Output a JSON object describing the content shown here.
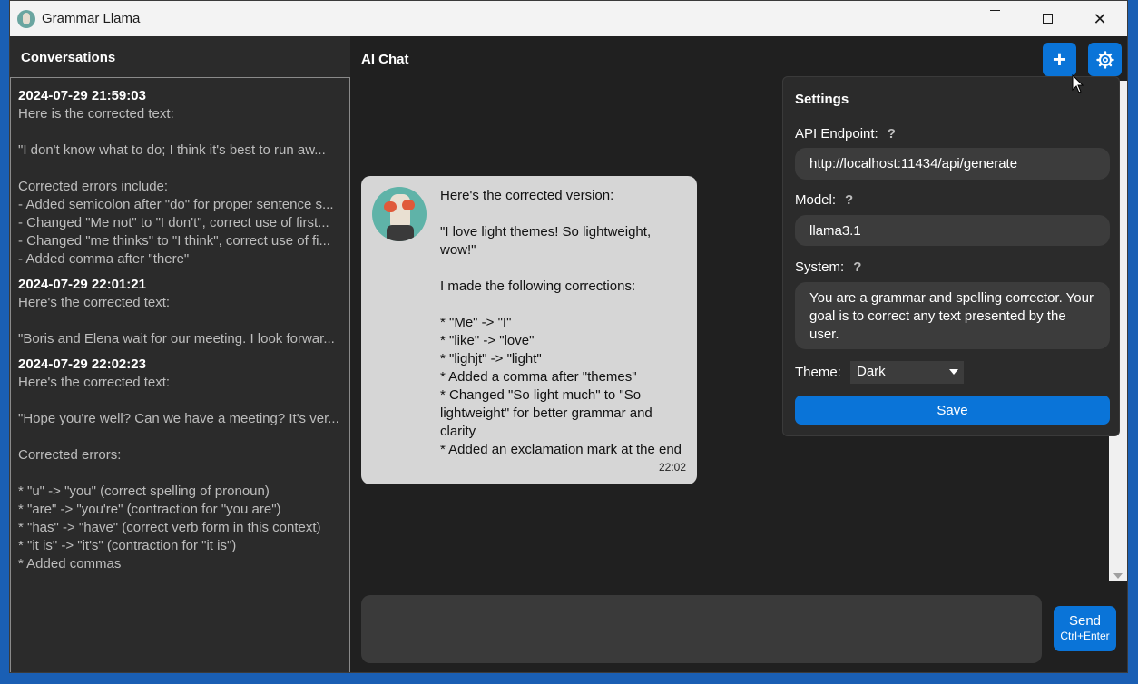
{
  "window": {
    "title": "Grammar Llama"
  },
  "sidebar": {
    "header": "Conversations",
    "conversations": [
      {
        "timestamp": "2024-07-29 21:59:03",
        "lines": [
          "Here is the corrected text:",
          "",
          "\"I don't know what to do; I think it's best to run aw...",
          "",
          "Corrected errors include:",
          "- Added semicolon after \"do\" for proper sentence s...",
          "- Changed \"Me not\" to \"I don't\", correct use of first...",
          "- Changed \"me thinks\" to \"I think\", correct use of fi...",
          "- Added comma after \"there\""
        ]
      },
      {
        "timestamp": "2024-07-29 22:01:21",
        "lines": [
          "Here's the corrected text:",
          "",
          "\"Boris and Elena wait for our meeting. I look forwar..."
        ]
      },
      {
        "timestamp": "2024-07-29 22:02:23",
        "lines": [
          "Here's the corrected text:",
          "",
          "\"Hope you're well? Can we have a meeting? It's ver...",
          "",
          "Corrected errors:",
          "",
          "* \"u\" -> \"you\" (correct spelling of pronoun)",
          "* \"are\" -> \"you're\" (contraction for \"you are\")",
          "* \"has\" -> \"have\" (correct verb form in this context)",
          "* \"it is\" -> \"it's\" (contraction for \"it is\")",
          "* Added commas"
        ]
      }
    ]
  },
  "chat": {
    "title": "AI Chat",
    "message": {
      "lines": [
        "Here's the corrected version:",
        "",
        "\"I love light themes! So lightweight,",
        "wow!\"",
        "",
        "I made the following corrections:",
        "",
        "* \"Me\" -> \"I\"",
        "* \"like\" -> \"love\"",
        "* \"lighjt\" -> \"light\"",
        "* Added a comma after \"themes\"",
        "* Changed \"So light much\" to \"So",
        "lightweight\" for better grammar and",
        "clarity",
        "* Added an exclamation mark at the end"
      ],
      "time": "22:02"
    },
    "input_value": "",
    "send": {
      "label": "Send",
      "hint": "Ctrl+Enter"
    }
  },
  "settings": {
    "title": "Settings",
    "api_endpoint_label": "API Endpoint:",
    "api_endpoint_value": "http://localhost:11434/api/generate",
    "model_label": "Model:",
    "model_value": "llama3.1",
    "system_label": "System:",
    "system_value": "You are a grammar and spelling corrector. Your goal is to correct any text presented by the user.",
    "theme_label": "Theme:",
    "theme_value": "Dark",
    "save_label": "Save",
    "help_glyph": "?"
  },
  "icons": {
    "new_chat": "plus-icon",
    "settings": "gear-icon",
    "close": "close-icon"
  },
  "colors": {
    "accent": "#0a74d8",
    "background": "#202020",
    "panel": "#2b2b2b"
  }
}
